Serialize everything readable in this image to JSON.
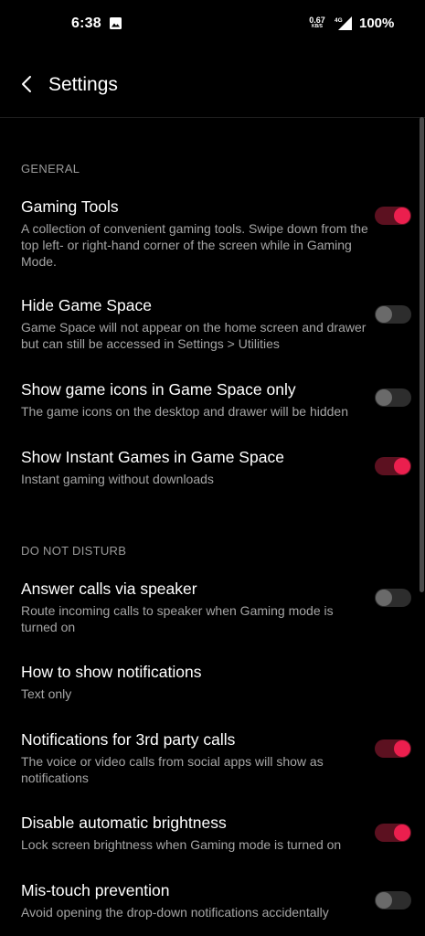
{
  "status_bar": {
    "time": "6:38",
    "image_icon": "image-icon",
    "speed_value": "0.67",
    "speed_unit": "KB/S",
    "network_type": "4G",
    "signal_icon": "signal-icon",
    "battery": "100%"
  },
  "header": {
    "back_icon": "chevron-left-icon",
    "title": "Settings"
  },
  "colors": {
    "accent": "#eb1f4e",
    "background": "#000000",
    "section_header": "#9a9a9a",
    "description": "#a5a5a5"
  },
  "sections": [
    {
      "header": "GENERAL",
      "items": [
        {
          "title": "Gaming Tools",
          "description": "A collection of convenient gaming tools. Swipe down from the top left- or right-hand corner of the screen while in Gaming Mode.",
          "toggle": true
        },
        {
          "title": "Hide Game Space",
          "description": "Game Space will not appear on the home screen and drawer but can still be accessed in Settings > Utilities",
          "toggle": false
        },
        {
          "title": "Show game icons in Game Space only",
          "description": "The game icons on the desktop and drawer will be hidden",
          "toggle": false
        },
        {
          "title": "Show Instant Games in Game Space",
          "description": "Instant gaming without downloads",
          "toggle": true
        }
      ]
    },
    {
      "header": "DO NOT DISTURB",
      "items": [
        {
          "title": "Answer calls via speaker",
          "description": "Route incoming calls to speaker when Gaming mode is turned on",
          "toggle": false
        },
        {
          "title": "How to show notifications",
          "description": "Text only"
        },
        {
          "title": "Notifications for 3rd party calls",
          "description": "The voice or video calls from social apps will show as notifications",
          "toggle": true
        },
        {
          "title": "Disable automatic brightness",
          "description": "Lock screen brightness when Gaming mode is turned on",
          "toggle": true
        },
        {
          "title": "Mis-touch prevention",
          "description": "Avoid opening the drop-down notifications accidentally",
          "toggle": false
        }
      ]
    }
  ]
}
